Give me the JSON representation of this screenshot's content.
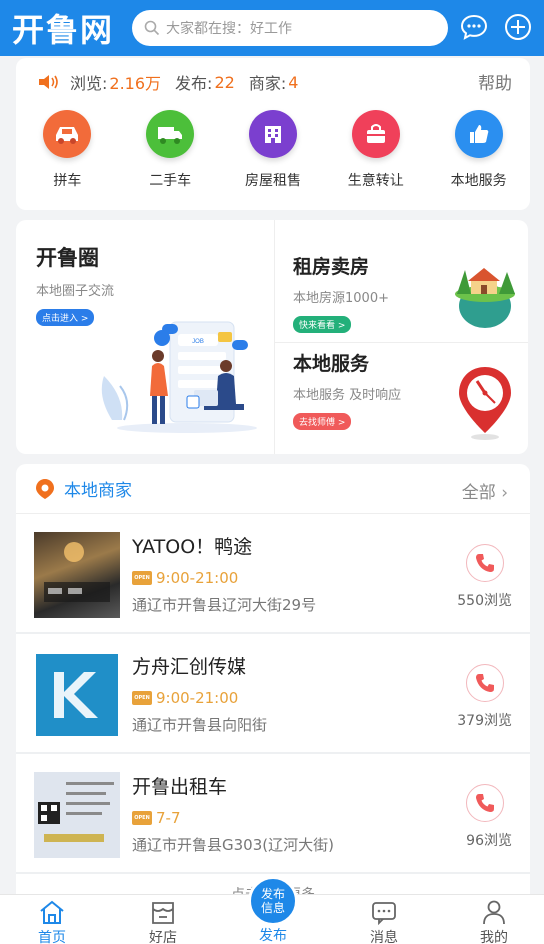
{
  "header": {
    "logo": "开鲁网",
    "search_placeholder": "大家都在搜：好工作"
  },
  "stats": {
    "views_label": "浏览:",
    "views_value": "2.16万",
    "posts_label": "发布:",
    "posts_value": "22",
    "merchants_label": "商家:",
    "merchants_value": "4",
    "help": "帮助"
  },
  "categories": [
    {
      "label": "拼车",
      "color": "#f26b3a"
    },
    {
      "label": "二手车",
      "color": "#4cbf3a"
    },
    {
      "label": "房屋租售",
      "color": "#7b3fcf"
    },
    {
      "label": "生意转让",
      "color": "#f0405a"
    },
    {
      "label": "本地服务",
      "color": "#2b8ff0"
    }
  ],
  "features": {
    "circle": {
      "title": "开鲁圈",
      "subtitle": "本地圈子交流",
      "pill": "点击进入 >"
    },
    "rent": {
      "title": "租房卖房",
      "subtitle": "本地房源1000+",
      "pill": "快来看看 >"
    },
    "service": {
      "title": "本地服务",
      "subtitle": "本地服务 及时响应",
      "pill": "去找师傅 >"
    }
  },
  "merchants_section": {
    "title": "本地商家",
    "all": "全部",
    "items": [
      {
        "name": "YATOO！鸭途",
        "hours": "9:00-21:00",
        "address": "通辽市开鲁县辽河大街29号",
        "views": "550浏览"
      },
      {
        "name": "方舟汇创传媒",
        "hours": "9:00-21:00",
        "address": "通辽市开鲁县向阳街",
        "views": "379浏览"
      },
      {
        "name": "开鲁出租车",
        "hours": "7-7",
        "address": "通辽市开鲁县G303(辽河大街)",
        "views": "96浏览"
      }
    ],
    "more": "点击查看更多"
  },
  "open_badge": "OPEN",
  "tabbar": {
    "home": "首页",
    "shops": "好店",
    "publish": "发布",
    "publish_btn_line1": "发布",
    "publish_btn_line2": "信息",
    "messages": "消息",
    "mine": "我的"
  },
  "colors": {
    "brand": "#1e88e8",
    "accent": "#f0701e"
  }
}
